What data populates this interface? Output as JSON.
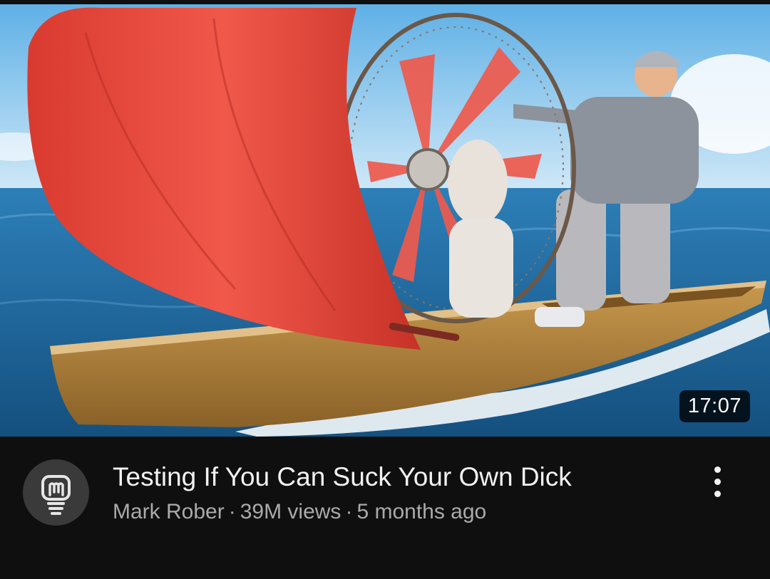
{
  "video": {
    "title": "Testing If You Can Suck Your Own Dick",
    "duration": "17:07",
    "channel": "Mark Rober",
    "separator": "·",
    "views": "39M views",
    "age": "5 months ago"
  },
  "icons": {
    "avatar": "lightbulb-logo-icon",
    "more": "vertical-ellipsis-icon"
  },
  "colors": {
    "background": "#0f0f0f",
    "title_text": "#f1f1f1",
    "meta_text": "#aaaaaa",
    "sail": "#e8473b",
    "sea": "#1f6fa5",
    "sky": "#8ec8ec"
  }
}
